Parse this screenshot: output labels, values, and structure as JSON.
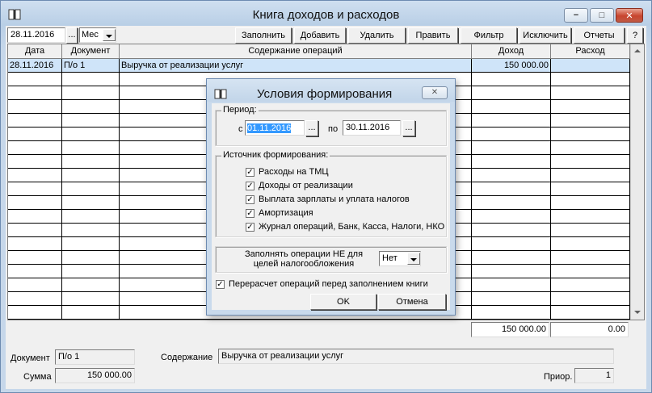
{
  "window": {
    "title": "Книга доходов и расходов"
  },
  "toolbar": {
    "date": "28.11.2016",
    "browse": "...",
    "period": "Мес",
    "buttons": [
      "Заполнить",
      "Добавить",
      "Удалить",
      "Править",
      "Фильтр",
      "Исключить",
      "Отчеты",
      "?"
    ]
  },
  "grid": {
    "headers": [
      "Дата",
      "Документ",
      "Содержание операций",
      "Доход",
      "Расход"
    ],
    "rows": [
      {
        "date": "28.11.2016",
        "doc": "П/о 1",
        "content": "Выручка от реализации услуг",
        "income": "150 000.00",
        "expense": ""
      }
    ],
    "totals": {
      "income": "150 000.00",
      "expense": "0.00"
    }
  },
  "details": {
    "doc_label": "Документ",
    "doc_value": "П/о 1",
    "content_label": "Содержание",
    "content_value": "Выручка от реализации услуг",
    "sum_label": "Сумма",
    "sum_value": "150 000.00",
    "prior_label": "Приор.",
    "prior_value": "1"
  },
  "dialog": {
    "title": "Условия формирования",
    "period_group": "Период:",
    "from_label": "с",
    "from_value": "01.11.2016",
    "to_label": "по",
    "to_value": "30.11.2016",
    "browse": "...",
    "source_group": "Источник формирования:",
    "sources": [
      {
        "label": "Расходы на ТМЦ",
        "checked": true
      },
      {
        "label": "Доходы от реализации",
        "checked": true
      },
      {
        "label": "Выплата зарплаты и уплата налогов",
        "checked": true
      },
      {
        "label": "Амортизация",
        "checked": true
      },
      {
        "label": "Журнал операций, Банк, Касса, Налоги, НКО",
        "checked": true
      }
    ],
    "fill_label_line1": "Заполнять операции НЕ для",
    "fill_label_line2": "целей налогообложения",
    "fill_value": "Нет",
    "recalc_label": "Перерасчет операций перед заполнением книги",
    "recalc_checked": true,
    "ok": "OK",
    "cancel": "Отмена"
  }
}
